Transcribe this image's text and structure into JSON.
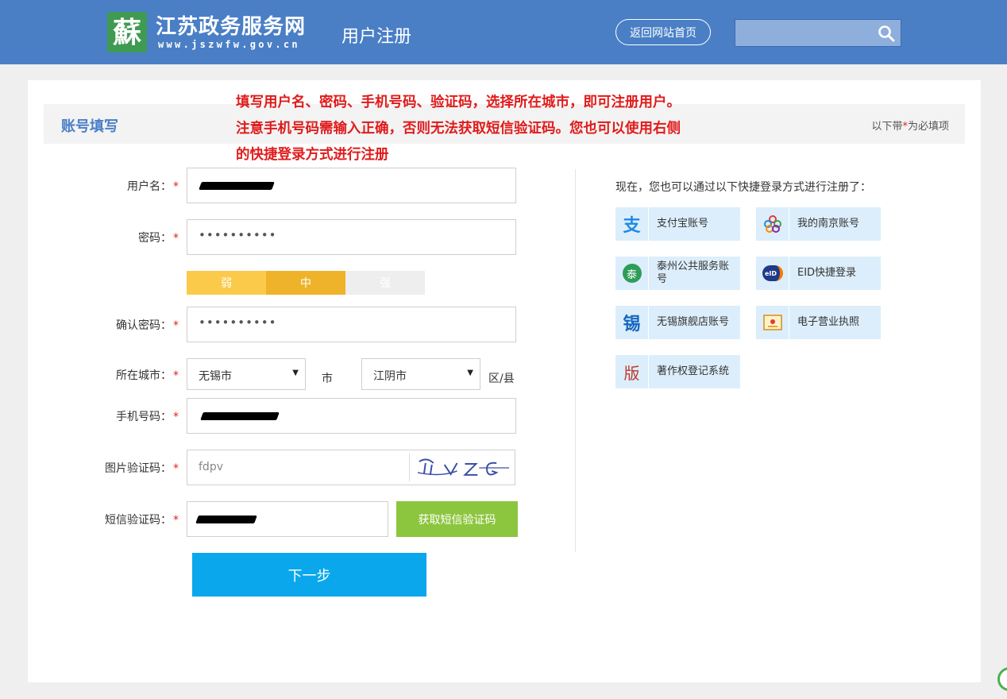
{
  "header": {
    "logo_glyph": "蘇",
    "site_name": "江苏政务服务网",
    "site_domain": "www.jszwfw.gov.cn",
    "page_heading": "用户注册",
    "home_button": "返回网站首页",
    "search_placeholder": ""
  },
  "section": {
    "title": "账号填写",
    "required_note_prefix": "以下带",
    "required_note_star": "*",
    "required_note_suffix": "为必填项"
  },
  "notice": {
    "line1": "填写用户名、密码、手机号码、验证码，选择所在城市，即可注册用户。",
    "line2": "注意手机号码需输入正确，否则无法获取短信验证码。您也可以使用右侧",
    "line3": "的快捷登录方式进行注册"
  },
  "form": {
    "username_label": "用户名：",
    "password_label": "密码：",
    "password_value": "••••••••••",
    "strength": [
      "弱",
      "中",
      "强"
    ],
    "strength_level": 2,
    "confirm_label": "确认密码：",
    "confirm_value": "••••••••••",
    "city_label": "所在城市：",
    "city_value": "无锡市",
    "city_unit": "市",
    "district_value": "江阴市",
    "district_unit": "区/县",
    "phone_label": "手机号码：",
    "captcha_label": "图片验证码：",
    "captcha_value": "fdpv",
    "sms_label": "短信验证码：",
    "sms_button": "获取短信验证码",
    "next_button": "下一步",
    "required_star": "*"
  },
  "quick_login": {
    "intro": "现在，您也可以通过以下快捷登录方式进行注册了：",
    "items": [
      {
        "label": "支付宝账号",
        "icon": "alipay-icon"
      },
      {
        "label": "我的南京账号",
        "icon": "nanjing-icon"
      },
      {
        "label": "泰州公共服务账号",
        "icon": "taizhou-icon"
      },
      {
        "label": "EID快捷登录",
        "icon": "eid-icon"
      },
      {
        "label": "无锡旗舰店账号",
        "icon": "wuxi-icon"
      },
      {
        "label": "电子营业执照",
        "icon": "business-license-icon"
      },
      {
        "label": "著作权登记系统",
        "icon": "copyright-icon"
      }
    ]
  },
  "colors": {
    "header_blue": "#4a7fc6",
    "strength_weak": "#fcca4a",
    "strength_medium": "#eeb32a",
    "strength_empty": "#eeeeee",
    "sms_green": "#8cc63f",
    "next_blue": "#0aa7ec",
    "required_red": "#e02020"
  }
}
